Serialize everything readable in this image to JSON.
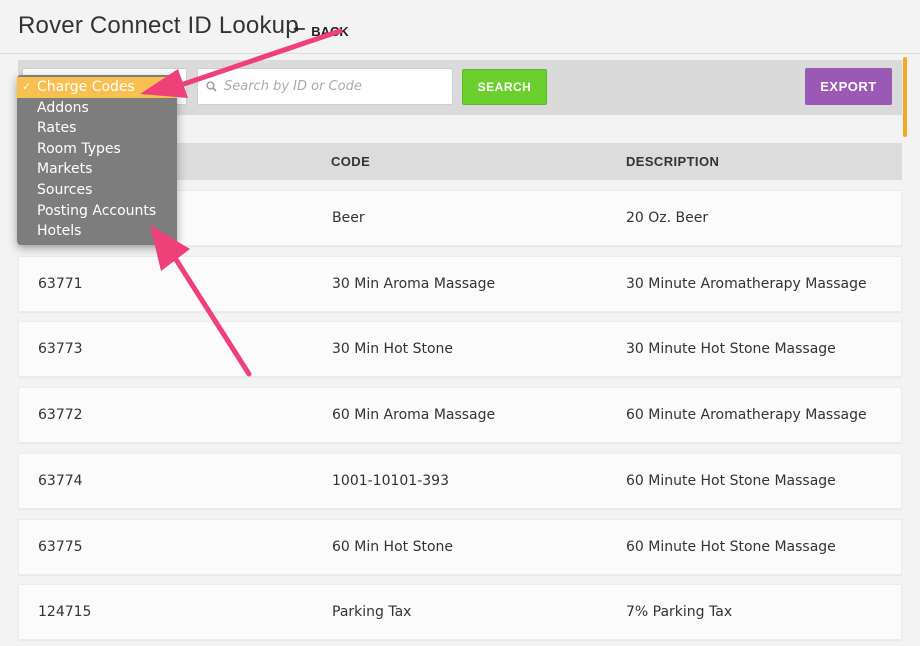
{
  "header": {
    "title": "Rover Connect ID Lookup",
    "back_label": "BACK"
  },
  "toolbar": {
    "search_placeholder": "Search by ID or Code",
    "search_button": "SEARCH",
    "export_button": "EXPORT"
  },
  "dropdown": {
    "selected_check": "✓",
    "items": [
      {
        "label": "Charge Codes"
      },
      {
        "label": "Addons"
      },
      {
        "label": "Rates"
      },
      {
        "label": "Room Types"
      },
      {
        "label": "Markets"
      },
      {
        "label": "Sources"
      },
      {
        "label": "Posting Accounts"
      },
      {
        "label": "Hotels"
      }
    ]
  },
  "table": {
    "columns": [
      "CODE",
      "DESCRIPTION"
    ],
    "rows": [
      {
        "id": "",
        "code": "Beer",
        "description": "20 Oz. Beer"
      },
      {
        "id": "63771",
        "code": "30 Min Aroma Massage",
        "description": "30 Minute Aromatherapy Massage"
      },
      {
        "id": "63773",
        "code": "30 Min Hot Stone",
        "description": "30 Minute Hot Stone Massage"
      },
      {
        "id": "63772",
        "code": "60 Min Aroma Massage",
        "description": "60 Minute Aromatherapy Massage"
      },
      {
        "id": "63774",
        "code": "1001-10101-393",
        "description": "60 Minute Hot Stone Massage"
      },
      {
        "id": "63775",
        "code": "60 Min Hot Stone",
        "description": "60 Minute Hot Stone Massage"
      },
      {
        "id": "124715",
        "code": "Parking Tax",
        "description": "7% Parking Tax"
      }
    ]
  },
  "colors": {
    "search_button": "#6bcf2e",
    "export_button": "#9b59b6",
    "dropdown_selected": "#f7c050",
    "annotation_arrow": "#f0407a"
  }
}
